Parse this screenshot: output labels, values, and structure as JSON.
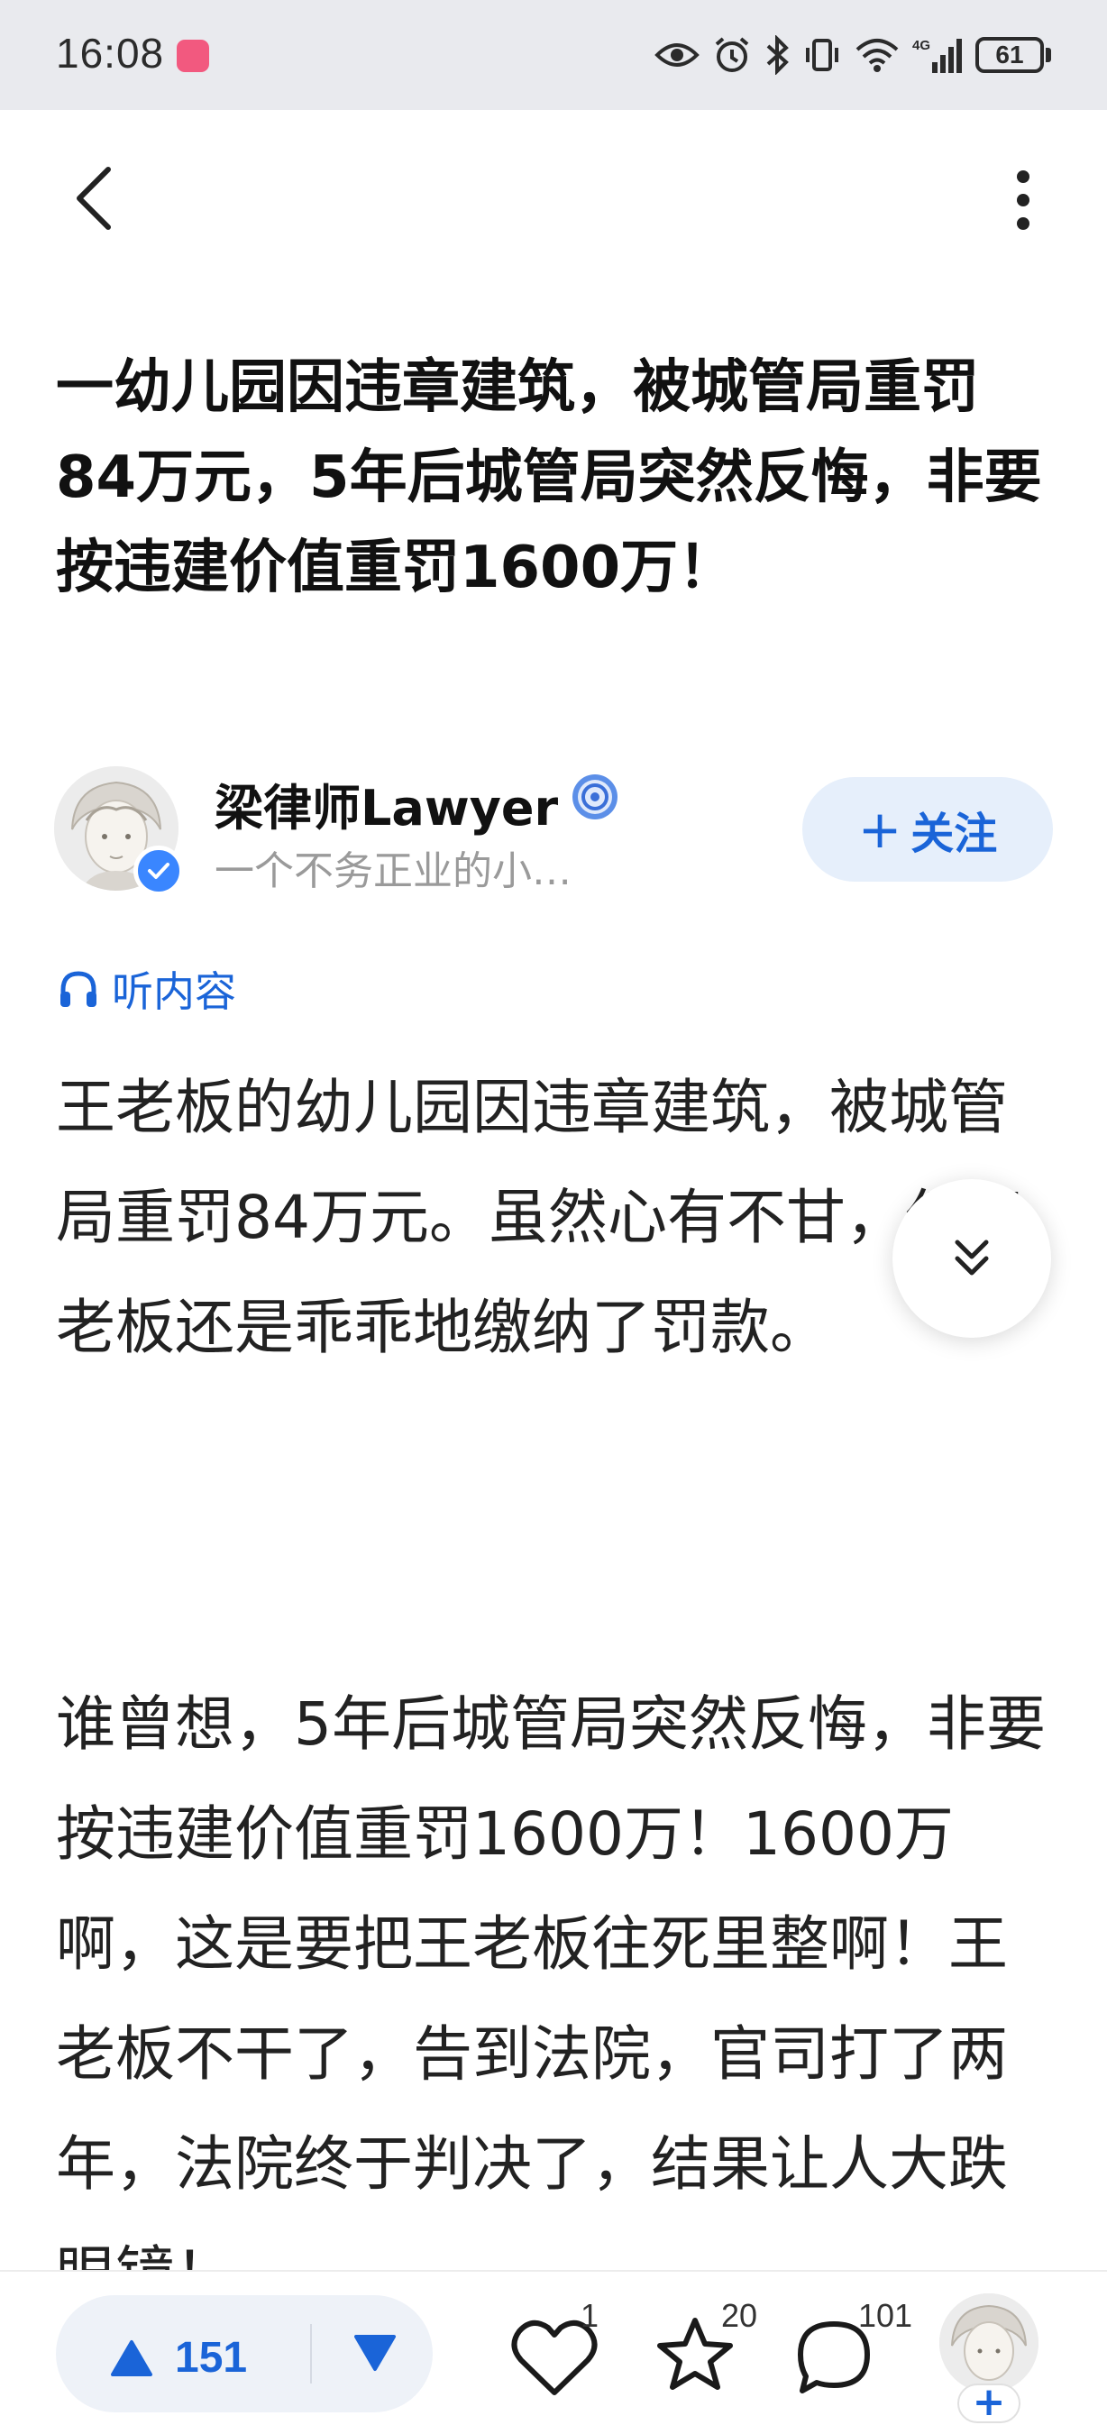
{
  "status_bar": {
    "time": "16:08",
    "app_icon": "bilibili-app-icon",
    "icons": [
      "eye-icon",
      "alarm-icon",
      "bluetooth-icon",
      "vibrate-icon",
      "wifi-icon",
      "signal-4g-icon"
    ],
    "battery": "61"
  },
  "nav": {
    "back_icon": "chevron-left-icon",
    "more_icon": "more-vertical-icon"
  },
  "article": {
    "title": "一幼儿园因违章建筑，被城管局重罚84万元，5年后城管局突然反悔，非要按违建价值重罚1600万！",
    "listen_label": "听内容",
    "paragraphs": [
      "王老板的幼儿园因违章建筑，被城管局重罚84万元。虽然心有不甘，但王老板还是乖乖地缴纳了罚款。",
      "谁曾想，5年后城管局突然反悔，非要按违建价值重罚1600万！1600万啊，这是要把王老板往死里整啊！王老板不干了，告到法院，官司打了两年，法院终于判决了，结果让人大跌眼镜！"
    ]
  },
  "author": {
    "name": "梁律师Lawyer",
    "description": "一个不务正业的小…",
    "follow_label": "关注",
    "follow_plus": "+"
  },
  "bottom_bar": {
    "upvotes": "151",
    "likes": "1",
    "favorites": "20",
    "comments": "101",
    "add_label": "+"
  },
  "colors": {
    "accent": "#1a64d8",
    "status_bar_bg": "#e9eaee",
    "follow_bg": "#e6effb"
  }
}
